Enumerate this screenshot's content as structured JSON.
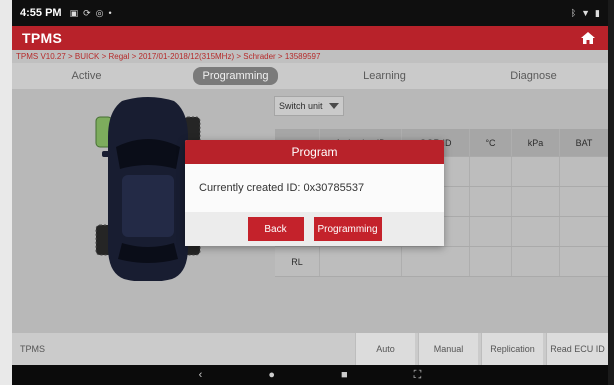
{
  "statusbar": {
    "time": "4:55 PM",
    "left_icons": [
      "notification-icon",
      "sync-icon",
      "location-icon",
      "dot-icon"
    ],
    "right_icons": [
      "bluetooth-icon",
      "wifi-icon",
      "battery-icon"
    ]
  },
  "app": {
    "title": "TPMS",
    "breadcrumb": "TPMS V10.27 > BUICK > Regal > 2017/01-2018/12(315MHz) > Schrader > 13589597"
  },
  "tabs": [
    {
      "label": "Active",
      "active": false
    },
    {
      "label": "Programming",
      "active": true
    },
    {
      "label": "Learning",
      "active": false
    },
    {
      "label": "Diagnose",
      "active": false
    }
  ],
  "switch_unit": {
    "label": "Switch unit"
  },
  "table": {
    "headers": [
      "",
      "Activation ID",
      "OOR ID",
      "°C",
      "kPa",
      "BAT"
    ],
    "rows": [
      [
        "",
        "",
        "",
        "",
        "",
        ""
      ],
      [
        "",
        "",
        "",
        "",
        "",
        ""
      ],
      [
        "",
        "",
        "",
        "",
        "",
        ""
      ],
      [
        "RL",
        "",
        "",
        "",
        "",
        ""
      ]
    ]
  },
  "bottombar": {
    "label": "TPMS",
    "buttons": [
      "Auto",
      "Manual",
      "Replication",
      "Read ECU ID"
    ]
  },
  "dialog": {
    "title": "Program",
    "message": "Currently created ID: 0x30785537",
    "back_label": "Back",
    "programming_label": "Programming"
  },
  "colors": {
    "brand_red": "#b8222a",
    "button_red": "#c4222b",
    "tire_highlight": "#8fc46a"
  }
}
